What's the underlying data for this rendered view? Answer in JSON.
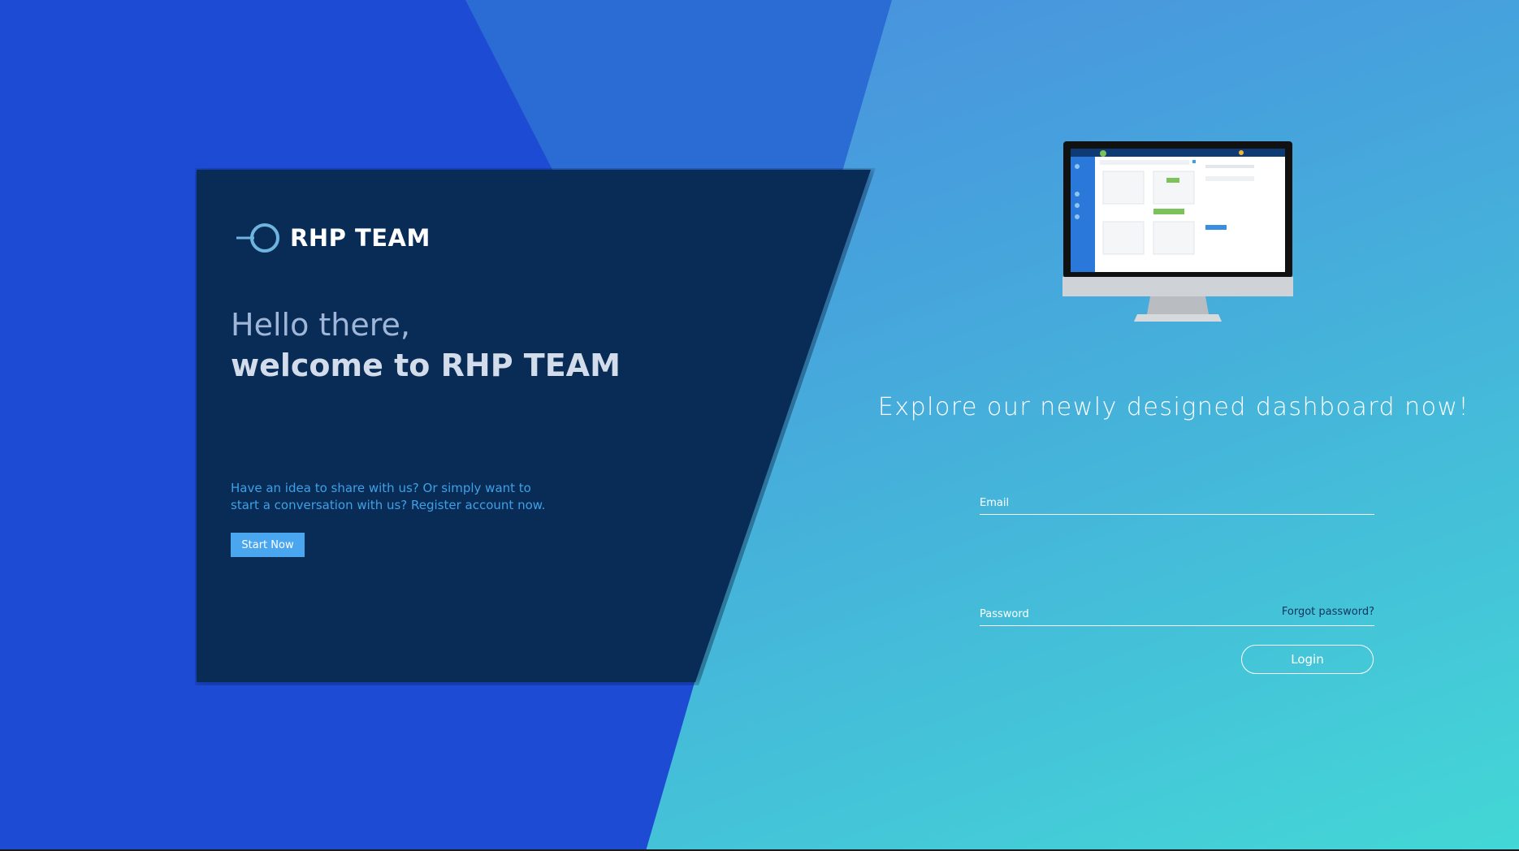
{
  "brand": {
    "name": "RHP TEAM"
  },
  "hero": {
    "greeting": "Hello there,",
    "welcome": "welcome to RHP TEAM",
    "pitch": "Have an idea to share with us? Or simply want to start a conversation with us? Register account now.",
    "start_button": "Start Now"
  },
  "login": {
    "tagline": "Explore our newly designed dashboard now!",
    "email_label": "Email",
    "email_value": "",
    "password_label": "Password",
    "password_value": "",
    "forgot_label": "Forgot password?",
    "login_button": "Login"
  },
  "colors": {
    "left_background": "#1d4bd4",
    "card": "#092c57",
    "accent_button": "#4aa7ef",
    "gradient_start": "#4b82e0",
    "gradient_end": "#43d7d6"
  },
  "icons": {
    "logo": "ring-logo-icon",
    "monitor": "desktop-monitor-illustration"
  }
}
